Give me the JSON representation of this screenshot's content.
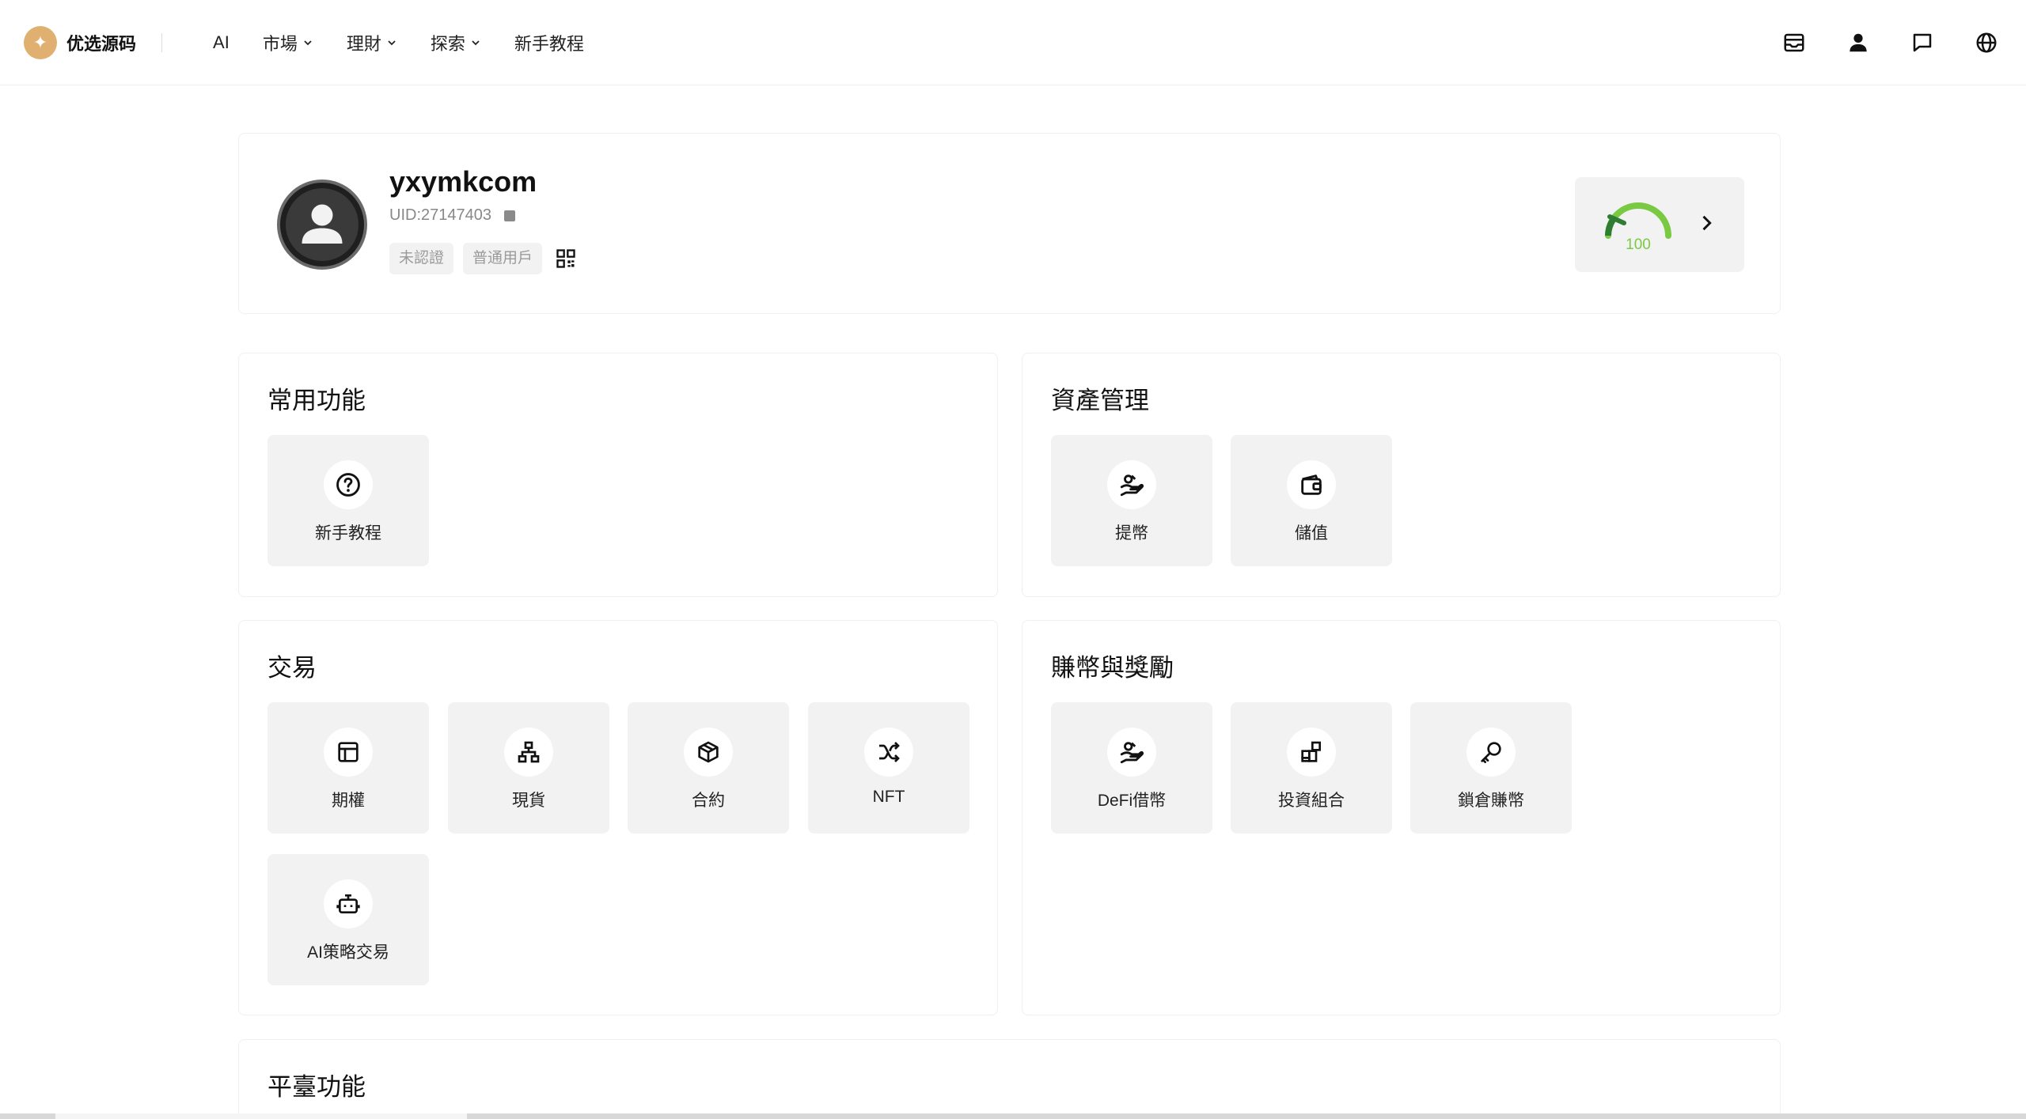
{
  "brand": {
    "logo_glyph": "✦",
    "name": "优选源码",
    "accent": "#e0b070"
  },
  "nav": [
    {
      "label": "AI",
      "dropdown": false
    },
    {
      "label": "市場",
      "dropdown": true
    },
    {
      "label": "理財",
      "dropdown": true
    },
    {
      "label": "探索",
      "dropdown": true
    },
    {
      "label": "新手教程",
      "dropdown": false
    }
  ],
  "header_icons": [
    "inbox-icon",
    "user-icon",
    "message-icon",
    "globe-icon"
  ],
  "profile": {
    "username": "yxymkcom",
    "uid": "UID:27147403",
    "tags": [
      "未認證",
      "普通用戶"
    ],
    "score": "100",
    "score_color": "#7ac943"
  },
  "sections": {
    "common": {
      "title": "常用功能",
      "items": [
        {
          "label": "新手教程",
          "icon": "help-circle-icon"
        }
      ]
    },
    "assets": {
      "title": "資產管理",
      "items": [
        {
          "label": "提幣",
          "icon": "hand-coin-icon"
        },
        {
          "label": "儲值",
          "icon": "wallet-icon"
        }
      ]
    },
    "trade": {
      "title": "交易",
      "items": [
        {
          "label": "期權",
          "icon": "layout-icon"
        },
        {
          "label": "現貨",
          "icon": "network-icon"
        },
        {
          "label": "合約",
          "icon": "box-icon"
        },
        {
          "label": "NFT",
          "icon": "shuffle-icon"
        },
        {
          "label": "AI策略交易",
          "icon": "robot-icon"
        }
      ]
    },
    "earn": {
      "title": "賺幣與獎勵",
      "items": [
        {
          "label": "DeFi借幣",
          "icon": "hand-coin-icon"
        },
        {
          "label": "投資組合",
          "icon": "blocks-icon"
        },
        {
          "label": "鎖倉賺幣",
          "icon": "key-icon"
        }
      ]
    },
    "platform": {
      "title": "平臺功能"
    }
  }
}
